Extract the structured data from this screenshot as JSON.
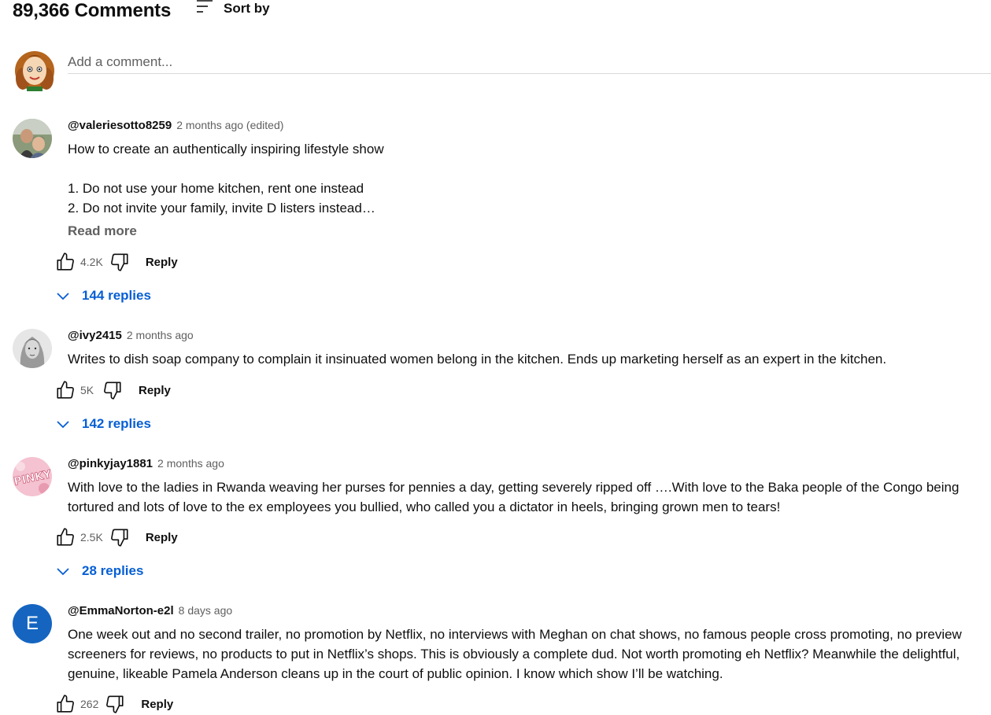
{
  "header": {
    "count_label": "89,366 Comments",
    "sort_label": "Sort by",
    "sort_icon": "sort-icon"
  },
  "add_comment": {
    "placeholder": "Add a comment..."
  },
  "colors": {
    "link_blue": "#065fd4",
    "text_secondary": "#606060",
    "avatar_e": "#1565c0"
  },
  "comments": [
    {
      "author": "@valeriesotto8259",
      "time": "2 months ago (edited)",
      "text": "How to create an authentically inspiring lifestyle show\n\n1. Do not use your home kitchen, rent one instead\n2. Do not invite your family, invite D listers instead…",
      "read_more": "Read more",
      "likes": "4.2K",
      "reply_label": "Reply",
      "replies_label": "144 replies"
    },
    {
      "author": "@ivy2415",
      "time": "2 months ago",
      "text": "Writes to dish soap company to complain it insinuated women belong in the kitchen. Ends up marketing herself as an expert in the kitchen.",
      "likes": "5K",
      "reply_label": "Reply",
      "replies_label": "142 replies"
    },
    {
      "author": "@pinkyjay1881",
      "time": "2 months ago",
      "text": "With love to the ladies in Rwanda weaving her purses for pennies a day, getting severely ripped off ….With love to the Baka people of the Congo being tortured and lots of love to the ex employees you bullied, who called you a dictator in heels, bringing grown men to tears!",
      "likes": "2.5K",
      "reply_label": "Reply",
      "replies_label": "28 replies",
      "avatar_text": "PINKY"
    },
    {
      "author": "@EmmaNorton-e2l",
      "time": "8 days ago",
      "text": "One week out and no second trailer, no promotion by Netflix, no interviews with Meghan on chat shows, no famous people cross promoting, no preview screeners for reviews, no products to put in Netflix’s shops. This is obviously a complete dud. Not worth promoting eh Netflix? Meanwhile the delightful, genuine, likeable Pamela Anderson cleans up in the court of public opinion. I know which show I’ll be watching.",
      "likes": "262",
      "reply_label": "Reply",
      "avatar_letter": "E"
    }
  ]
}
